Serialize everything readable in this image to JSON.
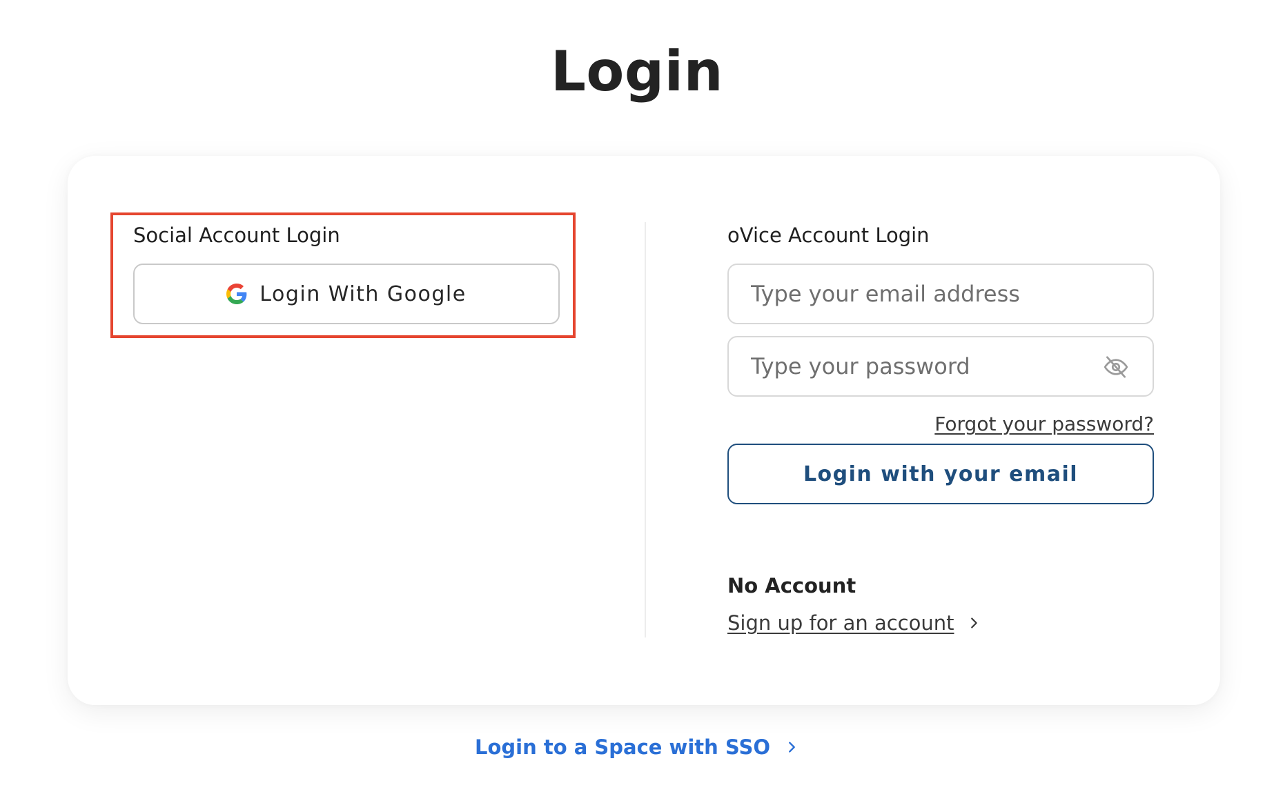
{
  "page": {
    "title": "Login"
  },
  "social": {
    "section_label": "Social Account Login",
    "google_button_label": "Login With Google",
    "google_icon": "google-g-icon"
  },
  "ovice": {
    "section_label": "oVice Account Login",
    "email_placeholder": "Type your email address",
    "email_value": "",
    "password_placeholder": "Type your password",
    "password_value": "",
    "password_visibility_icon": "eye-slash-icon",
    "forgot_password_label": "Forgot your password?",
    "login_button_label": "Login with your email"
  },
  "no_account": {
    "section_label": "No Account",
    "signup_label": "Sign up for an account",
    "signup_icon": "chevron-right-icon"
  },
  "sso": {
    "label": "Login to a Space with SSO",
    "icon": "chevron-right-icon"
  },
  "colors": {
    "highlight_border": "#e5452f",
    "primary_navy": "#1f4e7d",
    "link_blue": "#2a6fd6",
    "google_blue": "#4285F4",
    "google_red": "#EA4335",
    "google_yellow": "#FBBC05",
    "google_green": "#34A853"
  }
}
